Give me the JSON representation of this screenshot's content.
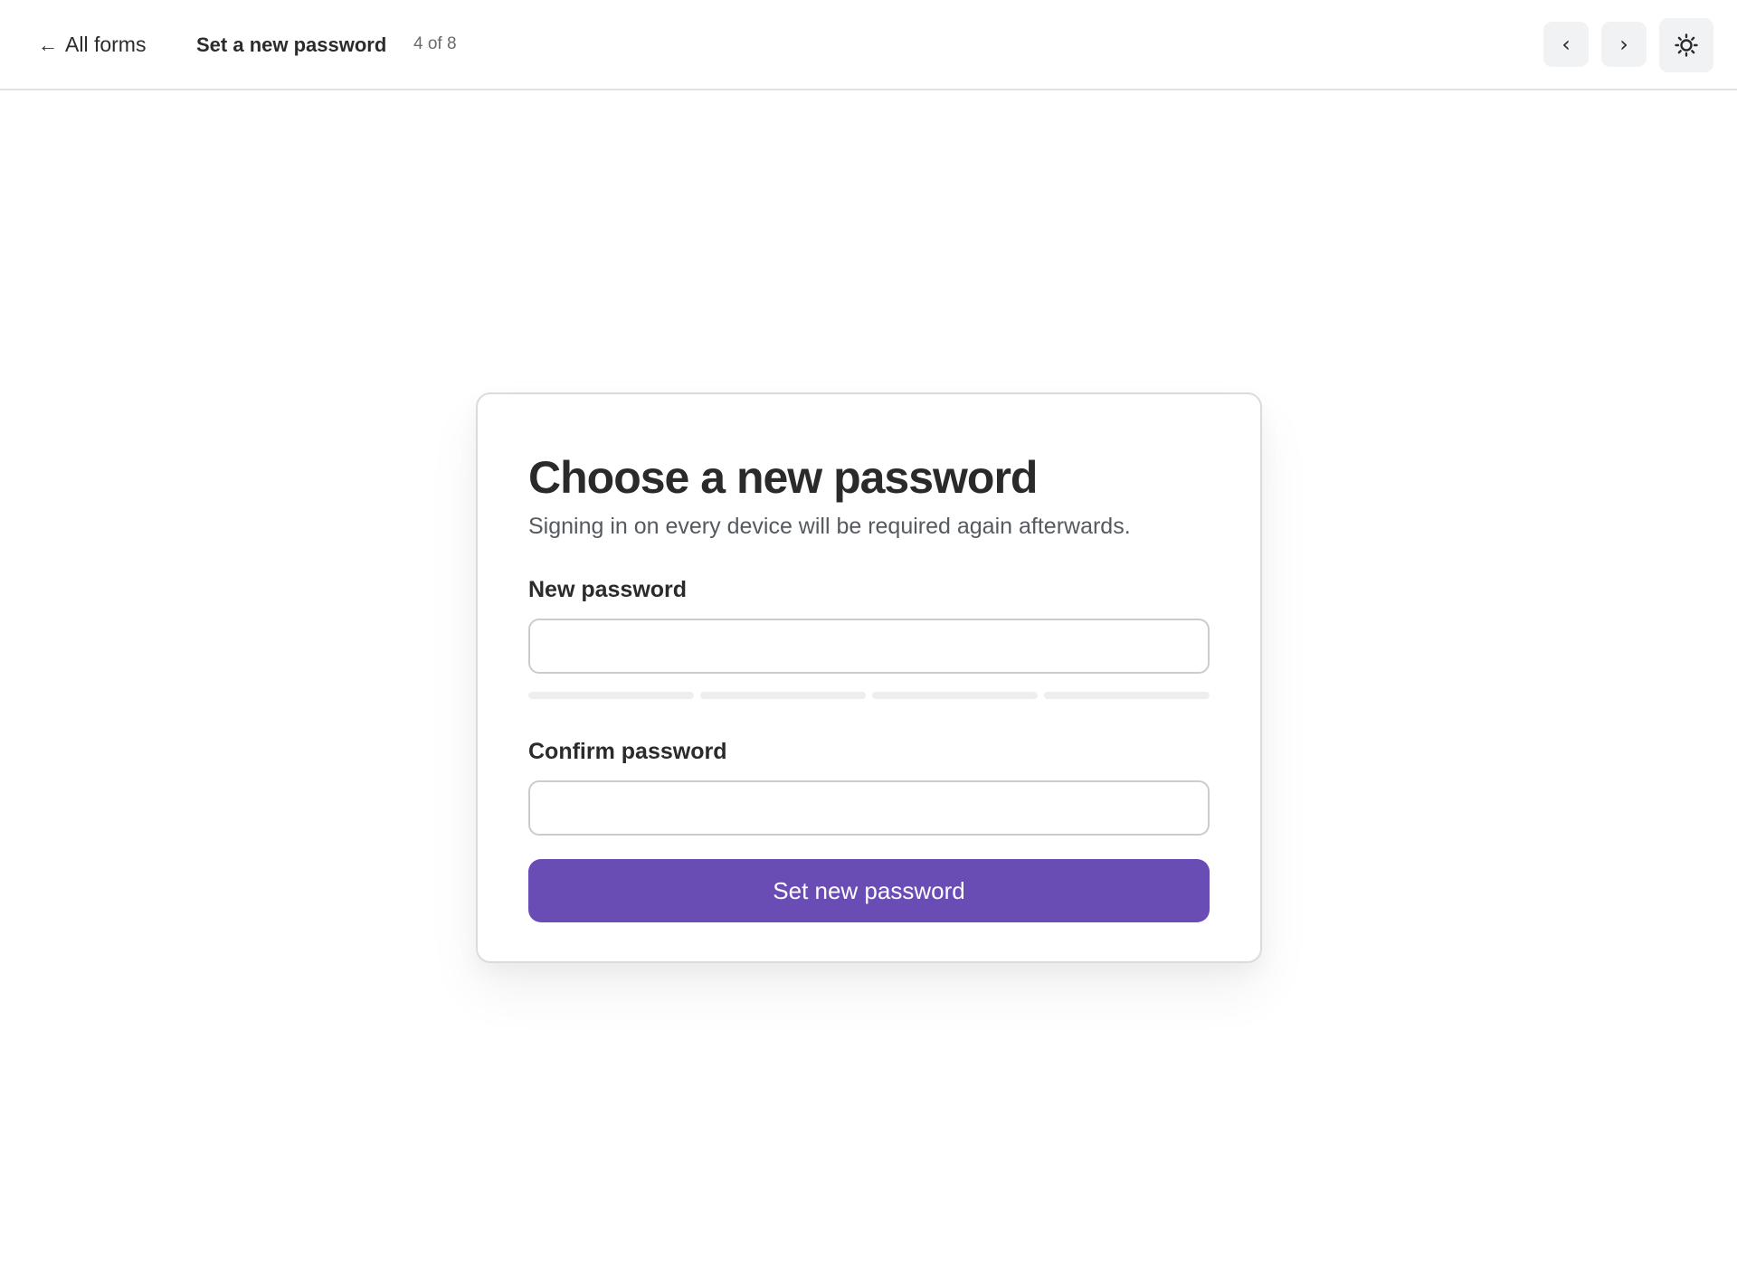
{
  "header": {
    "back_label": "All forms",
    "back_icon": "arrow-left-icon",
    "form_title": "Set a new password",
    "counter": "4 of 8",
    "prev_glyph": "‹",
    "next_glyph": "›",
    "theme_icon": "sun-icon"
  },
  "card": {
    "title": "Choose a new password",
    "subtitle": "Signing in on every device will be required again afterwards.",
    "new_password": {
      "label": "New password",
      "value": "",
      "strength_segments": 4,
      "strength_filled": 0
    },
    "confirm_password": {
      "label": "Confirm password",
      "value": ""
    },
    "submit_label": "Set new password"
  },
  "colors": {
    "accent": "#6a4cb5",
    "meter_empty": "#eceef0",
    "border": "#d9dcdf"
  }
}
